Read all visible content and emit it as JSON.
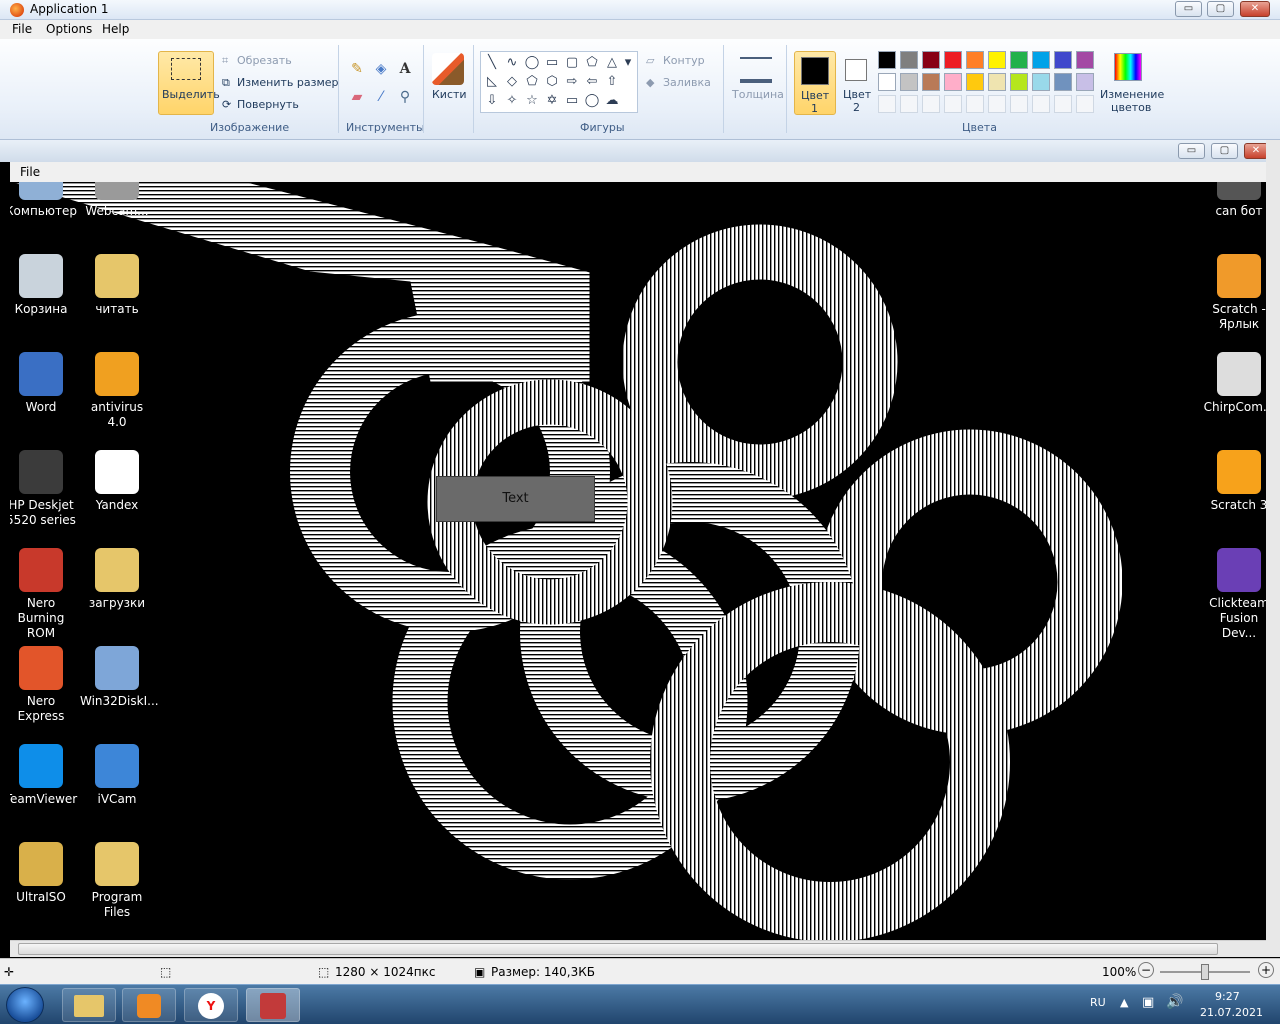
{
  "window": {
    "title": "Application 1",
    "minimize": "▭",
    "maximize": "▢",
    "close": "✕"
  },
  "menu": {
    "file": "File",
    "options": "Options",
    "help": "Help"
  },
  "ribbon": {
    "select_label": "Выделить",
    "crop_label": "Обрезать",
    "resize_label": "Изменить размер",
    "rotate_label": "Повернуть",
    "image_group": "Изображение",
    "tools_group": "Инструменты",
    "brushes_label": "Кисти",
    "shapes_group": "Фигуры",
    "outline_label": "Контур",
    "fill_label": "Заливка",
    "thickness_label": "Толщина",
    "color1_line1": "Цвет",
    "color1_line2": "1",
    "color2_line1": "Цвет",
    "color2_line2": "2",
    "edit_colors_line1": "Изменение",
    "edit_colors_line2": "цветов",
    "colors_group": "Цвета",
    "palette_row1": [
      "#000000",
      "#7f7f7f",
      "#880015",
      "#ed1c24",
      "#ff7f27",
      "#fff200",
      "#22b14c",
      "#00a2e8",
      "#3f48cc",
      "#a349a4"
    ],
    "palette_row2": [
      "#ffffff",
      "#c3c3c3",
      "#b97a57",
      "#ffaec9",
      "#ffc90e",
      "#efe4b0",
      "#b5e61d",
      "#99d9ea",
      "#7092be",
      "#c8bfe7"
    ]
  },
  "inner_menu": {
    "file": "File"
  },
  "canvas": {
    "text_button": "Text"
  },
  "desktop_left": [
    {
      "line1": "Компьютер",
      "line2": "",
      "color": "#8fb0d6"
    },
    {
      "line1": "Webcam...",
      "line2": "",
      "color": "#9a9a9a"
    },
    {
      "line1": "Корзина",
      "line2": "",
      "color": "#c9d3dc"
    },
    {
      "line1": "читать",
      "line2": "",
      "color": "#e6c66a"
    },
    {
      "line1": "Word",
      "line2": "",
      "color": "#3a6fc4"
    },
    {
      "line1": "antivirus 4.0",
      "line2": "",
      "color": "#f0a020"
    },
    {
      "line1": "HP Deskjet",
      "line2": "5520 series",
      "color": "#3b3b3b"
    },
    {
      "line1": "Yandex",
      "line2": "",
      "color": "#ffffff"
    },
    {
      "line1": "Nero Burning",
      "line2": "ROM",
      "color": "#c8392b"
    },
    {
      "line1": "загрузки",
      "line2": "",
      "color": "#e6c66a"
    },
    {
      "line1": "Nero Express",
      "line2": "",
      "color": "#e2552a"
    },
    {
      "line1": "Win32DiskI...",
      "line2": "",
      "color": "#7ea6d8"
    },
    {
      "line1": "TeamViewer",
      "line2": "",
      "color": "#0e8ee9"
    },
    {
      "line1": "iVCam",
      "line2": "",
      "color": "#3d86d8"
    },
    {
      "line1": "UltraISO",
      "line2": "",
      "color": "#d9b04a"
    },
    {
      "line1": "Program",
      "line2": "Files",
      "color": "#e6c66a"
    }
  ],
  "desktop_right": [
    {
      "line1": "can бот",
      "line2": "",
      "color": "#555555"
    },
    {
      "line1": "Scratch -",
      "line2": "Ярлык",
      "color": "#f09a2a"
    },
    {
      "line1": "ChirpCom...",
      "line2": "",
      "color": "#dddddd"
    },
    {
      "line1": "Scratch 3",
      "line2": "",
      "color": "#f7a21b"
    },
    {
      "line1": "Clickteam",
      "line2": "Fusion Dev...",
      "color": "#6a3fb5"
    }
  ],
  "status": {
    "dimensions": "1280 × 1024пкс",
    "size": "Размер: 140,3КБ",
    "zoom": "100%",
    "zoom_level": 100
  },
  "taskbar": {
    "lang": "RU",
    "time": "9:27",
    "date": "21.07.2021"
  }
}
